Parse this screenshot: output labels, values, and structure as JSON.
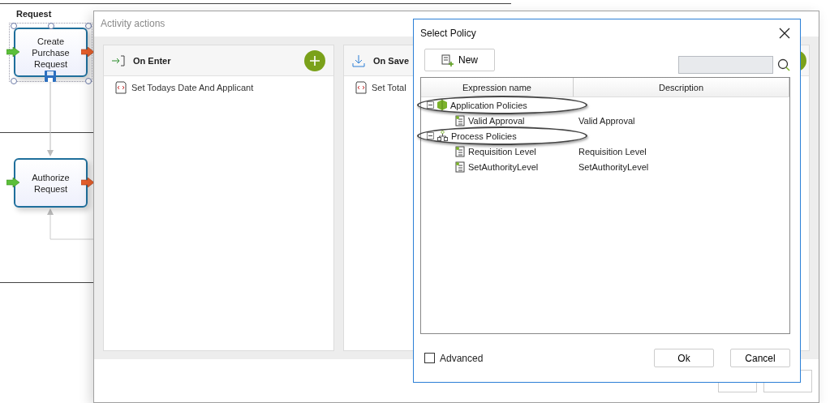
{
  "diagram": {
    "lane_title": "Request",
    "nodes": [
      {
        "label": "Create Purchase Request",
        "selected": true
      },
      {
        "label": "Authorize Request",
        "selected": false
      }
    ]
  },
  "activity_window": {
    "title": "Activity actions",
    "panels": [
      {
        "title": "On Enter",
        "kind": "enter",
        "items": [
          "Set Todays Date And Applicant"
        ]
      },
      {
        "title": "On Save",
        "kind": "save",
        "items": [
          "Set Total"
        ]
      }
    ]
  },
  "dialog": {
    "title": "Select Policy",
    "new_button": "New",
    "columns": [
      "Expression name",
      "Description"
    ],
    "tree": [
      {
        "name": "Application Policies",
        "kind": "application",
        "expanded": true,
        "circled": true,
        "children": [
          {
            "name": "Valid Approval",
            "description": "Valid Approval"
          }
        ]
      },
      {
        "name": "Process Policies",
        "kind": "process",
        "expanded": true,
        "circled": true,
        "children": [
          {
            "name": "Requisition Level",
            "description": "Requisition Level"
          },
          {
            "name": "SetAuthorityLevel",
            "description": "SetAuthorityLevel"
          }
        ]
      }
    ],
    "advanced": {
      "label": "Advanced",
      "checked": false
    },
    "buttons": [
      "Ok",
      "Cancel"
    ]
  }
}
